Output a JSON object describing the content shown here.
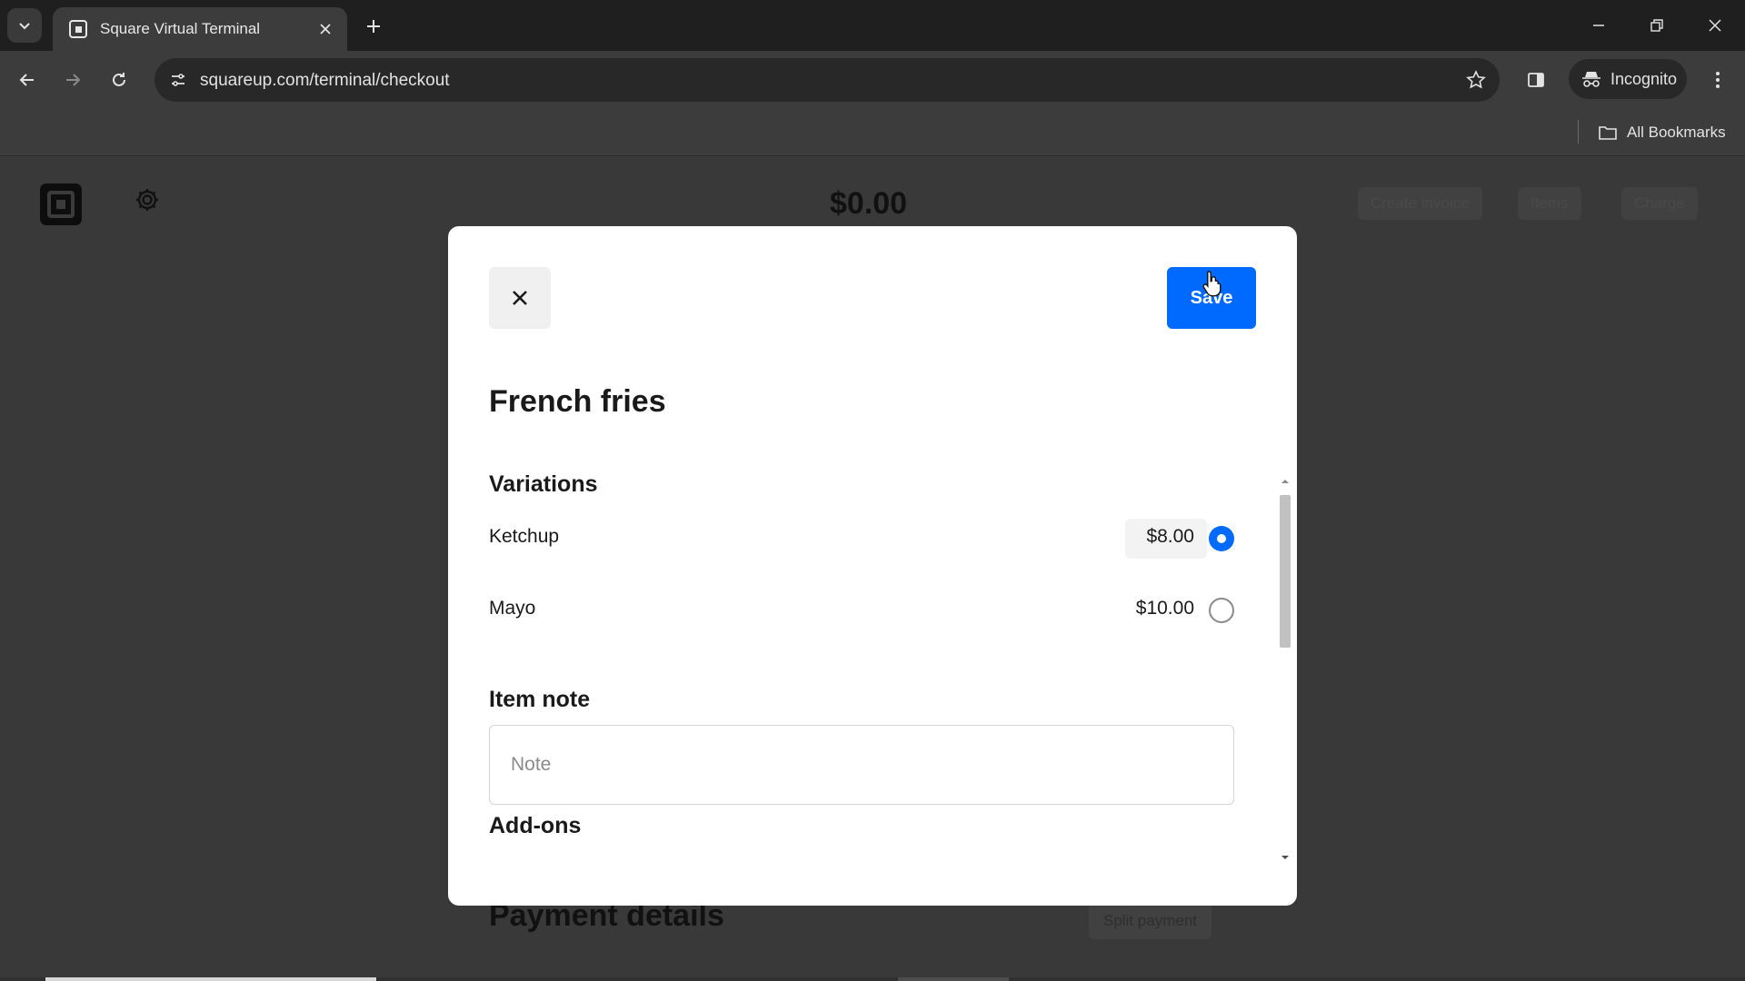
{
  "browser": {
    "tab_title": "Square Virtual Terminal",
    "url": "squareup.com/terminal/checkout",
    "profile_label": "Incognito",
    "bookmarks_label": "All Bookmarks"
  },
  "page": {
    "total": "$0.00",
    "top_actions": [
      "Create invoice",
      "Items",
      "Charge"
    ],
    "payment_details_heading": "Payment details",
    "split_payment_label": "Split payment"
  },
  "modal": {
    "close_icon": "close-icon",
    "save_label": "Save",
    "title": "French fries",
    "variations_heading": "Variations",
    "variations": [
      {
        "name": "Ketchup",
        "price": "$8.00",
        "selected": true
      },
      {
        "name": "Mayo",
        "price": "$10.00",
        "selected": false
      }
    ],
    "item_note_heading": "Item note",
    "note_placeholder": "Note",
    "note_value": "",
    "addons_heading": "Add-ons"
  },
  "colors": {
    "accent": "#006aff",
    "overlay": "#393939",
    "chrome_dark": "#1f1f1f",
    "chrome": "#3c3c3c"
  }
}
